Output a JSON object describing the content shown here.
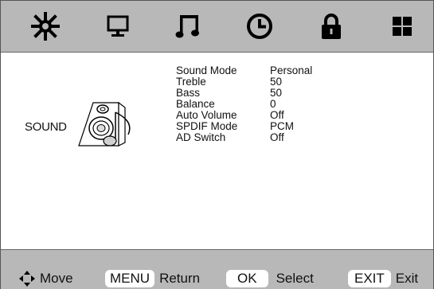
{
  "menu_tabs": [
    {
      "icon": "picture-icon"
    },
    {
      "icon": "monitor-icon"
    },
    {
      "icon": "music-note-icon"
    },
    {
      "icon": "clock-icon"
    },
    {
      "icon": "lock-icon"
    },
    {
      "icon": "grid-icon"
    }
  ],
  "section": {
    "label": "SOUND",
    "icon": "speaker-icon"
  },
  "settings": [
    {
      "label": "Sound Mode",
      "value": "Personal"
    },
    {
      "label": "Treble",
      "value": "50"
    },
    {
      "label": "Bass",
      "value": "50"
    },
    {
      "label": "Balance",
      "value": "0"
    },
    {
      "label": "Auto Volume",
      "value": "Off"
    },
    {
      "label": "SPDIF Mode",
      "value": "PCM"
    },
    {
      "label": "AD Switch",
      "value": "Off"
    }
  ],
  "footer": {
    "move_label": "Move",
    "menu_key": "MENU",
    "menu_label": "Return",
    "ok_key": "OK",
    "ok_label": "Select",
    "exit_key": "EXIT",
    "exit_label": "Exit"
  },
  "colors": {
    "bar": "#b8b8b8",
    "panel": "#ffffff",
    "icon": "#000000"
  }
}
